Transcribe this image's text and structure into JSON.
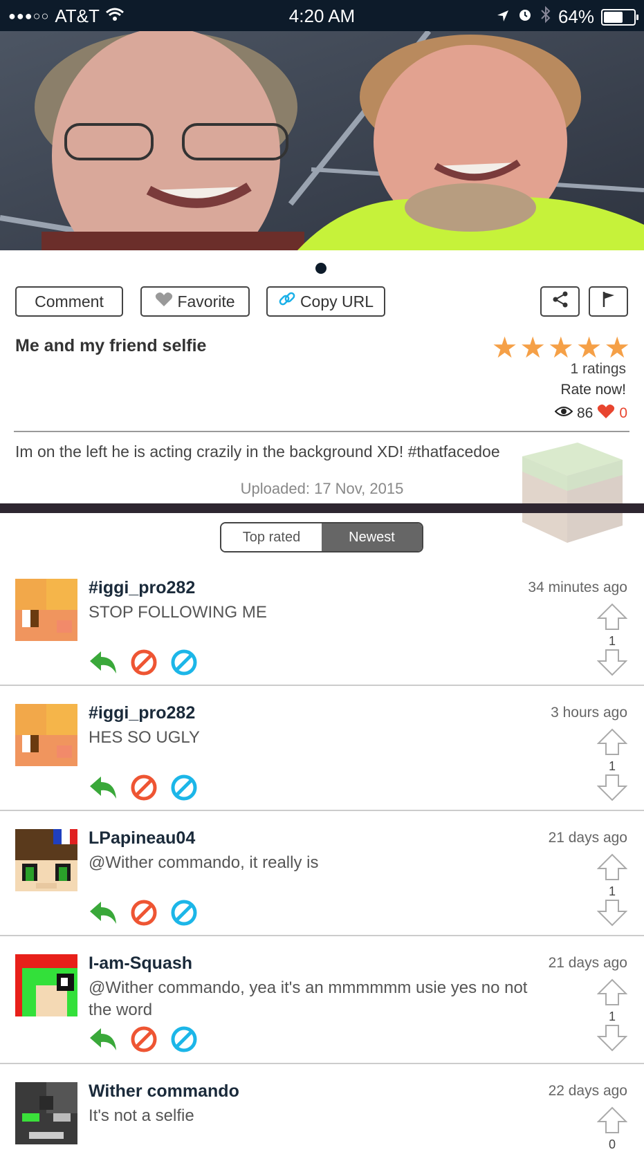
{
  "status_bar": {
    "carrier": "AT&T",
    "time": "4:20 AM",
    "battery": "64%",
    "battery_level": 0.64,
    "icons": [
      "signal-dots-icon",
      "wifi-icon",
      "location-arrow-icon",
      "alarm-icon",
      "bluetooth-icon",
      "battery-icon"
    ]
  },
  "post": {
    "buttons": {
      "comment": "Comment",
      "favorite": "Favorite",
      "copy_url": "Copy URL"
    },
    "title": "Me and my friend selfie",
    "rating_stars": 5,
    "ratings_count": "1 ratings",
    "rate_now": "Rate now!",
    "views": "86",
    "likes": "0",
    "description": "Im on the left he is acting crazily in the background XD! #thatfacedoe",
    "uploaded": "Uploaded: 17 Nov, 2015",
    "colors": {
      "star": "#f5a047",
      "heart": "#e8452f",
      "link_icon": "#1ab0e8"
    }
  },
  "sort_tabs": {
    "top_rated": "Top rated",
    "newest": "Newest",
    "selected": "Newest"
  },
  "comments": [
    {
      "user": "#iggi_pro282",
      "time": "34 minutes ago",
      "text": "STOP FOLLOWING ME",
      "votes": "1"
    },
    {
      "user": "#iggi_pro282",
      "time": "3 hours ago",
      "text": "HES SO UGLY",
      "votes": "1"
    },
    {
      "user": "LPapineau04",
      "time": "21 days ago",
      "text": "@Wither commando, it really is",
      "votes": "1"
    },
    {
      "user": "I-am-Squash",
      "time": "21 days ago",
      "text": "@Wither commando, yea it's an mmmmmm usie yes no not the word",
      "votes": "1"
    },
    {
      "user": "Wither commando",
      "time": "22 days ago",
      "text": "It's not a selfie",
      "votes": "0"
    }
  ],
  "action_colors": {
    "reply": "#3aa83a",
    "block": "#ee5533",
    "report": "#1cb6e8"
  }
}
